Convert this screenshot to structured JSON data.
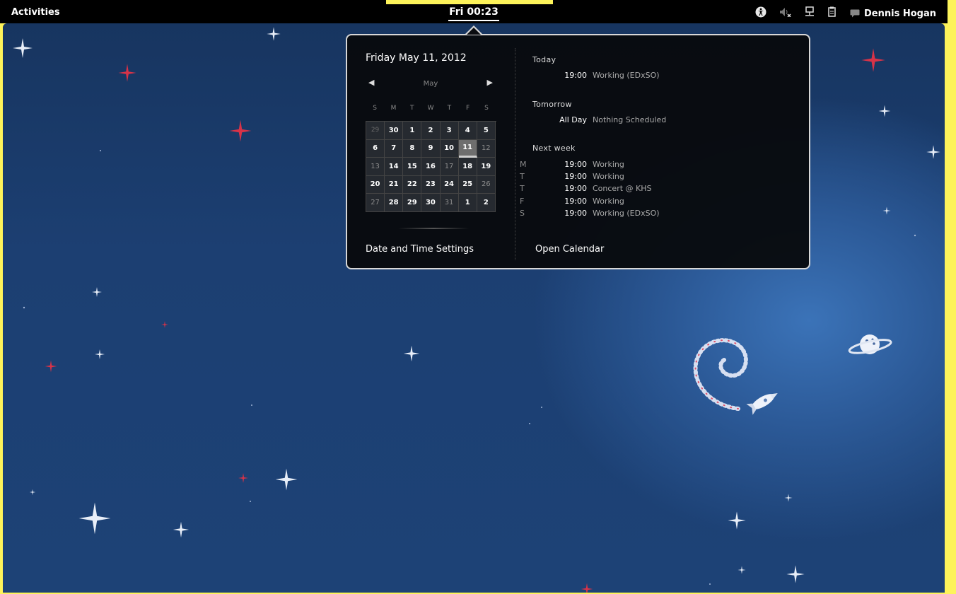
{
  "topbar": {
    "activities": "Activities",
    "clock": "Fri 00:23",
    "user": "Dennis Hogan",
    "icons": [
      "accessibility-icon",
      "volume-muted-icon",
      "network-wired-icon",
      "clipboard-icon",
      "chat-icon"
    ]
  },
  "calendar": {
    "date_title": "Friday May 11, 2012",
    "month": "May",
    "weekdays": [
      "S",
      "M",
      "T",
      "W",
      "T",
      "F",
      "S"
    ],
    "weeks": [
      [
        "29",
        "30",
        "1",
        "2",
        "3",
        "4",
        "5"
      ],
      [
        "6",
        "7",
        "8",
        "9",
        "10",
        "11",
        "12"
      ],
      [
        "13",
        "14",
        "15",
        "16",
        "17",
        "18",
        "19"
      ],
      [
        "20",
        "21",
        "22",
        "23",
        "24",
        "25",
        "26"
      ],
      [
        "27",
        "28",
        "29",
        "30",
        "31",
        "1",
        "2"
      ]
    ],
    "selected_day": "11",
    "settings_label": "Date and Time Settings"
  },
  "events": {
    "today_header": "Today",
    "today": [
      {
        "day": "",
        "time": "19:00",
        "name": "Working (EDxSO)"
      }
    ],
    "tomorrow_header": "Tomorrow",
    "tomorrow": [
      {
        "day": "",
        "time": "All Day",
        "name": "Nothing Scheduled"
      }
    ],
    "nextweek_header": "Next week",
    "nextweek": [
      {
        "day": "M",
        "time": "19:00",
        "name": "Working"
      },
      {
        "day": "T",
        "time": "19:00",
        "name": "Working"
      },
      {
        "day": "T",
        "time": "19:00",
        "name": "Concert @ KHS"
      },
      {
        "day": "F",
        "time": "19:00",
        "name": "Working"
      },
      {
        "day": "S",
        "time": "19:00",
        "name": "Working (EDxSO)"
      }
    ],
    "open_calendar": "Open Calendar"
  },
  "colors": {
    "panel": "#000000",
    "desktop_base": "#1c3f72",
    "desktop_glow": "#3b73b8",
    "popup_bg": "#080a0e",
    "popup_border": "#d7d7d7",
    "highlight": "#fdf35a"
  }
}
